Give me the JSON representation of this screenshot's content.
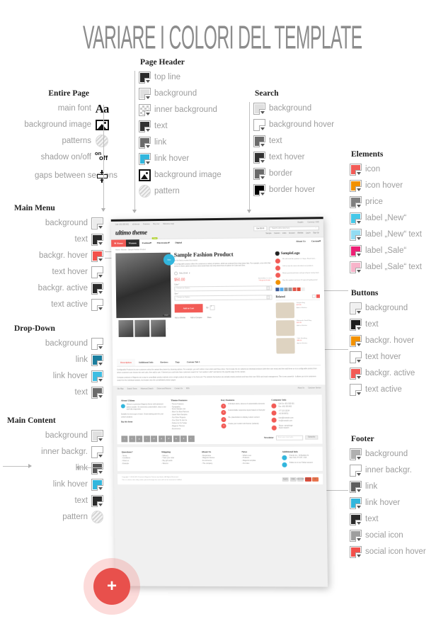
{
  "title": "VARIARE I COLORI DEL TEMPLATE",
  "groups": {
    "entire_page": {
      "title": "Entire Page",
      "items": [
        {
          "label": "main font",
          "icon": "font-aa-icon"
        },
        {
          "label": "background image",
          "icon": "image-icon"
        },
        {
          "label": "patterns",
          "icon": "pattern-icon"
        },
        {
          "label": "shadow on/off",
          "icon": "onoff-icon",
          "on": "on",
          "off": "off"
        },
        {
          "label": "gaps between sections",
          "icon": "gaps-icon"
        }
      ]
    },
    "page_header": {
      "title": "Page Header",
      "items": [
        {
          "label": "top line",
          "color": "#2b2b2b"
        },
        {
          "label": "background",
          "color": "#e0e0e0"
        },
        {
          "label": "inner background",
          "color": "checker"
        },
        {
          "label": "text",
          "color": "#333333"
        },
        {
          "label": "link",
          "color": "#6b6b6b"
        },
        {
          "label": "link hover",
          "color": "#32b6dd"
        },
        {
          "label": "background image",
          "color": "image"
        },
        {
          "label": "pattern",
          "color": "pattern"
        }
      ]
    },
    "search": {
      "title": "Search",
      "items": [
        {
          "label": "background",
          "color": "#e0e0e0"
        },
        {
          "label": "background hover",
          "color": "#ffffff"
        },
        {
          "label": "text",
          "color": "#6b6b6b"
        },
        {
          "label": "text hover",
          "color": "#333333"
        },
        {
          "label": "border",
          "color": "#6b6b6b"
        },
        {
          "label": "border hover",
          "color": "#000000"
        }
      ]
    },
    "elements": {
      "title": "Elements",
      "items": [
        {
          "label": "icon",
          "color": "#f25b56"
        },
        {
          "label": "icon hover",
          "color": "#f29100"
        },
        {
          "label": "price",
          "color": "#808080"
        },
        {
          "label": "label „New“",
          "color": "#45c8e8"
        },
        {
          "label": "label „New“ text",
          "color": "#93dcf2"
        },
        {
          "label": "label „Sale“",
          "color": "#ec1f74"
        },
        {
          "label": "label „Sale“ text",
          "color": "#f7b4ca"
        }
      ]
    },
    "buttons": {
      "title": "Buttons",
      "items": [
        {
          "label": "background",
          "color": "#f0f0f0"
        },
        {
          "label": "text",
          "color": "#1d1d1d"
        },
        {
          "label": "backgr. hover",
          "color": "#f29100"
        },
        {
          "label": "text hover",
          "color": "#ffffff"
        },
        {
          "label": "backgr. active",
          "color": "#f25b56"
        },
        {
          "label": "text active",
          "color": "#ffffff"
        }
      ]
    },
    "main_menu": {
      "title": "Main Menu",
      "items": [
        {
          "label": "background",
          "color": "#ececec"
        },
        {
          "label": "text",
          "color": "#2b2b2b"
        },
        {
          "label": "backgr. hover",
          "color": "#f2504b"
        },
        {
          "label": "text hover",
          "color": "#ffffff"
        },
        {
          "label": "backgr. active",
          "color": "#2b2b2b"
        },
        {
          "label": "text active",
          "color": "#ffffff"
        }
      ]
    },
    "drop_down": {
      "title": "Drop-Down",
      "items": [
        {
          "label": "background",
          "color": "#ffffff"
        },
        {
          "label": "link",
          "color": "#1b7e9e"
        },
        {
          "label": "link hover",
          "color": "#3ebde2"
        },
        {
          "label": "text",
          "color": "#6b6b6b"
        }
      ]
    },
    "main_content": {
      "title": "Main Content",
      "items": [
        {
          "label": "background",
          "color": "#e0e0e0"
        },
        {
          "label": "inner backgr.",
          "color": "#ffffff"
        },
        {
          "label": "link",
          "color": "#555555"
        },
        {
          "label": "link hover",
          "color": "#32b6dd"
        },
        {
          "label": "text",
          "color": "#2b2b2b"
        },
        {
          "label": "pattern",
          "color": "pattern"
        }
      ]
    },
    "footer": {
      "title": "Footer",
      "items": [
        {
          "label": "background",
          "color": "#b0b0b0"
        },
        {
          "label": "inner backgr.",
          "color": "#ffffff"
        },
        {
          "label": "link",
          "color": "#5e5e5e"
        },
        {
          "label": "link hover",
          "color": "#32b6dd"
        },
        {
          "label": "text",
          "color": "#2b2b2b"
        },
        {
          "label": "social icon",
          "color": "#9e9e9e"
        },
        {
          "label": "social icon hover",
          "color": "#f2504b"
        }
      ]
    }
  },
  "mockup": {
    "topbar": {
      "phone": "Call +001 555 801",
      "links": [
        "all demos",
        "Features",
        "Buy me!",
        "Welcome msg!"
      ],
      "language": "English",
      "currency": "Currency: USD"
    },
    "logo": "ultimo theme",
    "cart": "Cart $0.00",
    "search_placeholder": "Search entire store here",
    "account_links": [
      "Sample",
      "Custom",
      "Links",
      "Account",
      "Wishlist",
      "Log In",
      "Sign Up"
    ],
    "nav": [
      {
        "label": "Home",
        "state": "active"
      },
      {
        "label": "Women",
        "state": "hover"
      },
      {
        "label": "Fashion",
        "state": "normal",
        "badge": "New"
      },
      {
        "label": "Electronics",
        "state": "normal"
      },
      {
        "label": "Digital",
        "state": "normal"
      }
    ],
    "nav_right": [
      "About Us",
      "Custom"
    ],
    "breadcrumb": "Home / Women / Sample Fashion Product",
    "product": {
      "title": "Sample Fashion Product",
      "review_link": "Be the first to review this product",
      "description": "A Configurable product offers the customers a variety of options, which are selected from drop-down lists. For example, a tee shirt that comes in three colors and three sizes would have two drop-down lists of options for Color and Size.",
      "availability_note": "Only 10 left",
      "price": "$50.00",
      "stock": "Availability: In stock",
      "required": "* Required Fields",
      "badge": "New",
      "zoom": "Zoom",
      "options": [
        {
          "label": "Color *",
          "value": "Choose an Option..."
        },
        {
          "label": "Size *",
          "value": "Choose an Option..."
        }
      ],
      "add_to_cart": "Add to Cart",
      "qty_label": "Qty",
      "qty_value": "1",
      "actions": [
        "Add to Wishlist",
        "Add to Compare",
        "Share"
      ]
    },
    "sidebar": {
      "logo": "SampleLogo",
      "benefits": [
        {
          "text": "We will send this product in 2 days. Read more...",
          "color": "#f25b56"
        },
        {
          "text": "Call us now for more info about our products",
          "color": "#f25b56"
        },
        {
          "text": "Return purchased items and get all your money back",
          "color": "#f25b56"
        },
        {
          "text": "Buy this product and earn 10 special loyalty points!",
          "color": "#f29100"
        }
      ],
      "related_title": "Related",
      "related": [
        {
          "name": "Sample Bag",
          "price": "$73.95",
          "link": "Add to Wishlist"
        },
        {
          "name": "Metropolis Small Bag",
          "price": "$22.95",
          "link": "Add to Wishlist"
        },
        {
          "name": "Vidie Handbag",
          "price": "$99.00",
          "link": "Add to Wishlist"
        }
      ]
    },
    "tabs": [
      {
        "label": "Description",
        "active": true
      },
      {
        "label": "Additional Info",
        "active": false
      },
      {
        "label": "Reviews",
        "active": false
      },
      {
        "label": "Tags",
        "active": false
      },
      {
        "label": "Custom Tab 1",
        "active": false
      }
    ],
    "tab_paragraphs": [
      "Configurable Products let your customers select the variant they desire by choosing options. For example, you sell t-shirts in two colors and three sizes. You'd create the six variants as individual products (with their own vinos) and then add these on to a configurable product from where customers can choose size and color, then add to cart. If desired you could also have customers search for \"red medium t-shirt\" and land on the specific page for the variant.",
      "Compare products in Magento are a way to consolidate product variants onto a single product info page in the front-end. The variants themselves are actually simple products and have their own SKUs and stock management. This is very powerful - it allows you to let customers search for the individual variants, but browse onto the consolidated product pages."
    ],
    "subfooter_left": [
      "Site Map",
      "Search Terms",
      "Advanced Search",
      "Orders and Returns",
      "Contact Us",
      "RSS"
    ],
    "subfooter_right": [
      "About Us",
      "Customer Service"
    ],
    "footer_cols": [
      {
        "title": "About Ultimo",
        "paragraphs": [
          "Ultimo is a premium Magento theme with advanced admin module. It's extremely customizable, easy to use and fully responsive.",
          "Suitable for every type of store. Great starting point for your custom projects."
        ],
        "link": "Buy this theme"
      },
      {
        "title": "Theme Features",
        "items": [
          "Theme Features",
          "Typography",
          "Some Sample Link",
          "Meet Our Best Partners",
          "Latest Work Samples",
          "Our Other Projects",
          "One Click To Join Us",
          "Follow Us On Twitter",
          "Magento Themes",
          "Ecommerce"
        ]
      },
      {
        "title": "Key Features",
        "numbered": [
          "Unlimited colors, dozens of customizable elements",
          "Customizable responsive layout based on fluid grid",
          "50+ placeholders to display custom content",
          "Create your custom sub-themes (variants)"
        ]
      },
      {
        "title": "Company Info",
        "contacts": [
          "Call Us +001 555 801\nFax +001 555 802",
          "+77 123 12234\n+42 98 98711",
          "boss@example.com\nme@example.com",
          "Skype: samplelogin\nskype-support"
        ]
      }
    ],
    "newsletter_label": "Newsletter",
    "newsletter_placeholder": "Enter your email addr...",
    "newsletter_button": "Subscribe",
    "footer2_cols": [
      {
        "title": "Questions?",
        "items": [
          "Terms",
          "Conditions",
          "About us",
          "Example"
        ]
      },
      {
        "title": "Shipping",
        "items": [
          "Delivery",
          "Track your order",
          "Buy gift cards",
          "Returns"
        ]
      },
      {
        "title": "About Us",
        "items": [
          "Responsive",
          "Magento themes",
          "E-commerce",
          "The company"
        ]
      },
      {
        "title": "News",
        "items": [
          "What's new",
          "Products",
          "Magento template",
          "Our sites"
        ]
      },
      {
        "title": "Additional Info",
        "contacts": [
          "Friends Inc., 30 Bedford St\nNew York, NY 047, USA",
          "Follow us on our Twitter account"
        ]
      }
    ],
    "copyright": "Copyright © 2013-2015 Premium Magento Themes by Infortis. All Rights Reserved.\nThis is a demo store. Any orders placed through this store will not be honored or fulfilled.",
    "cards": [
      "PayPal",
      "VISA",
      "DISCOVER",
      "AMEX",
      "MC"
    ]
  },
  "plus_button": {
    "label": "+"
  }
}
